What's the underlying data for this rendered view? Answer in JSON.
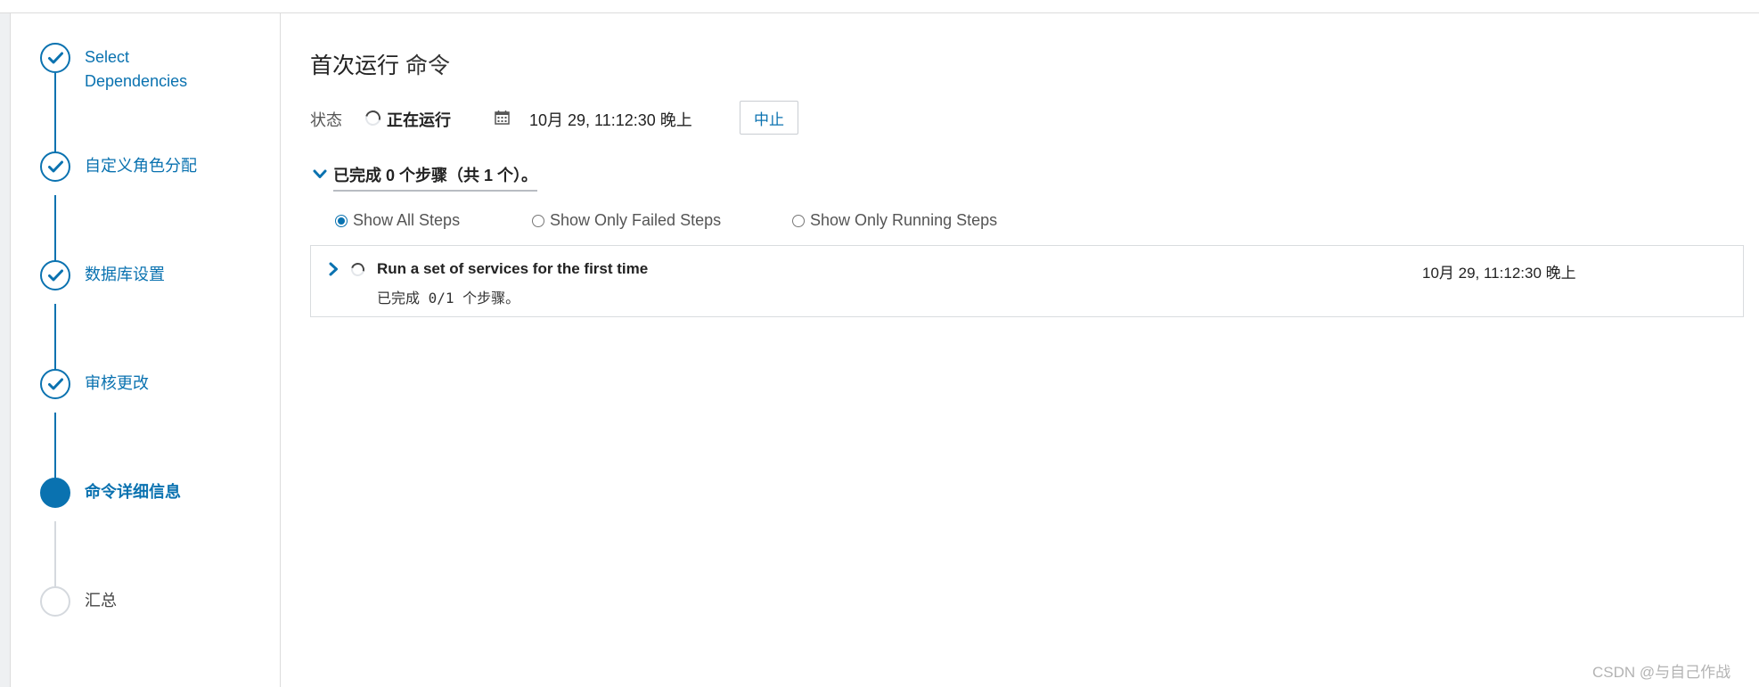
{
  "wizard": {
    "steps": [
      {
        "label_line1": "Select",
        "label_line2": "Dependencies",
        "state": "done"
      },
      {
        "label_line1": "自定义角色分配",
        "state": "done"
      },
      {
        "label_line1": "数据库设置",
        "state": "done"
      },
      {
        "label_line1": "审核更改",
        "state": "done"
      },
      {
        "label_line1": "命令详细信息",
        "state": "current"
      },
      {
        "label_line1": "汇总",
        "state": "pending"
      }
    ]
  },
  "header": {
    "title": "首次运行",
    "subtitle": "命令"
  },
  "status": {
    "label": "状态",
    "value": "正在运行",
    "time": "10月 29, 11:12:30 晚上",
    "abort_label": "中止"
  },
  "summary": {
    "text": "已完成 0 个步骤（共 1 个）。"
  },
  "filters": {
    "options": [
      {
        "label": "Show All Steps",
        "checked": true
      },
      {
        "label": "Show Only Failed Steps",
        "checked": false
      },
      {
        "label": "Show Only Running Steps",
        "checked": false
      }
    ]
  },
  "command_steps": [
    {
      "title": "Run a set of services for the first time",
      "time": "10月 29, 11:12:30 晚上",
      "progress_text": "已完成 0/1 个步骤。"
    }
  ],
  "colors": {
    "accent": "#0a72b0",
    "pending": "#d5d9de"
  },
  "watermark": "CSDN @与自己作战"
}
